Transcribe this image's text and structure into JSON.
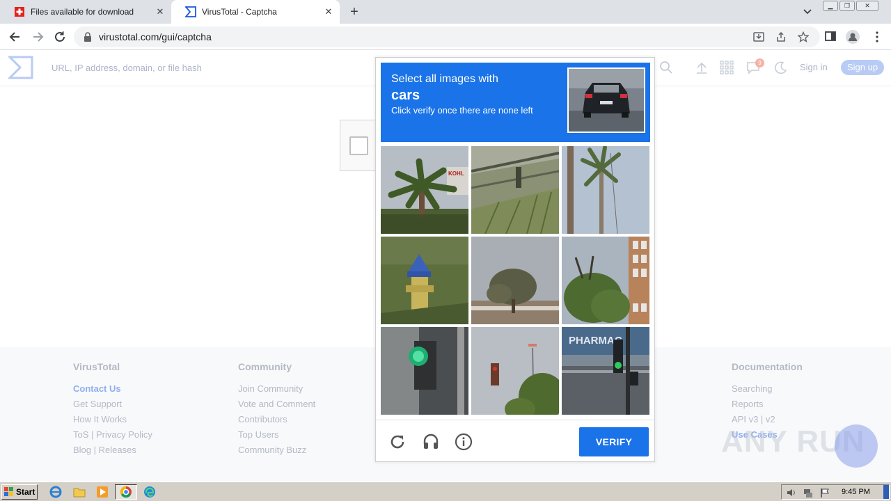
{
  "browser": {
    "tabs": [
      {
        "title": "Files available for download",
        "active": false,
        "icon": "swiss-flag-icon"
      },
      {
        "title": "VirusTotal - Captcha",
        "active": true,
        "icon": "virustotal-logo-icon"
      }
    ],
    "url": "virustotal.com/gui/captcha"
  },
  "vt": {
    "search_placeholder": "URL, IP address, domain, or file hash",
    "notification_count": "9",
    "signin": "Sign in",
    "signup": "Sign up"
  },
  "footer": {
    "columns": [
      {
        "heading": "VirusTotal",
        "links": [
          "Contact Us",
          "Get Support",
          "How It Works",
          "ToS | Privacy Policy",
          "Blog | Releases"
        ]
      },
      {
        "heading": "Community",
        "links": [
          "Join Community",
          "Vote and Comment",
          "Contributors",
          "Top Users",
          "Community Buzz"
        ]
      },
      {
        "heading": "Documentation",
        "links": [
          "Searching",
          "Reports",
          "API v3 | v2",
          "Use Cases"
        ]
      }
    ]
  },
  "captcha": {
    "instruction": "Select all images with",
    "target": "cars",
    "hint": "Click verify once there are none left",
    "verify_label": "VERIFY",
    "tiles": [
      "palm-tree",
      "railing-grass",
      "palm-pole",
      "fire-hydrant",
      "tree-roof",
      "tree-building",
      "traffic-light",
      "traffic-light-tree",
      "pharmacy-traffic-light"
    ],
    "pharmacy_sign": "PHARMAC"
  },
  "watermark": "ANY RUN",
  "taskbar": {
    "start": "Start",
    "clock": "9:45 PM"
  }
}
